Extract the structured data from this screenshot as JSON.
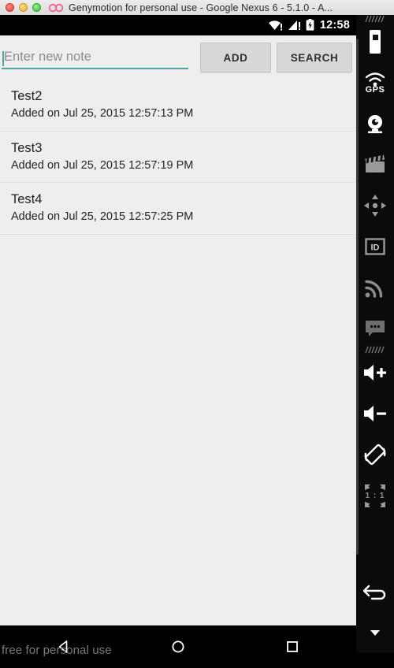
{
  "window": {
    "title": "Genymotion for personal use - Google Nexus 6 - 5.1.0 - A...",
    "controls": {
      "close": "close-button",
      "minimize": "minimize-button",
      "zoom": "zoom-button"
    },
    "logo": "genymotion-logo"
  },
  "statusbar": {
    "wifi_icon": "wifi-warning-icon",
    "signal_icon": "cellular-warning-icon",
    "battery_icon": "battery-charging-icon",
    "clock": "12:58"
  },
  "toolbar": {
    "input_value": "",
    "input_placeholder": "Enter new note",
    "add_label": "ADD",
    "search_label": "SEARCH",
    "accent_color": "#4ea79e"
  },
  "notes": [
    {
      "title": "Test2",
      "subtitle": "Added on Jul 25, 2015 12:57:13 PM"
    },
    {
      "title": "Test3",
      "subtitle": "Added on Jul 25, 2015 12:57:19 PM"
    },
    {
      "title": "Test4",
      "subtitle": "Added on Jul 25, 2015 12:57:25 PM"
    }
  ],
  "navbar": {
    "back": "back-triangle-icon",
    "home": "home-circle-icon",
    "recents": "recents-square-icon",
    "watermark": "free for personal use"
  },
  "gm_toolbar": {
    "items": [
      {
        "name": "battery-widget-icon",
        "label": ""
      },
      {
        "name": "gps-icon",
        "label": "GPS"
      },
      {
        "name": "camera-icon",
        "label": ""
      },
      {
        "name": "screen-record-icon",
        "label": ""
      },
      {
        "name": "dpad-icon",
        "label": ""
      },
      {
        "name": "identifiers-icon",
        "label": "ID"
      },
      {
        "name": "network-icon",
        "label": ""
      },
      {
        "name": "sms-icon",
        "label": ""
      },
      {
        "name": "volume-up-icon",
        "label": ""
      },
      {
        "name": "volume-down-icon",
        "label": ""
      },
      {
        "name": "rotate-screen-icon",
        "label": ""
      },
      {
        "name": "zoom-one-to-one-icon",
        "label": "1 : 1"
      },
      {
        "name": "back-arrow-icon",
        "label": ""
      },
      {
        "name": "more-chevron-icon",
        "label": ""
      }
    ]
  }
}
